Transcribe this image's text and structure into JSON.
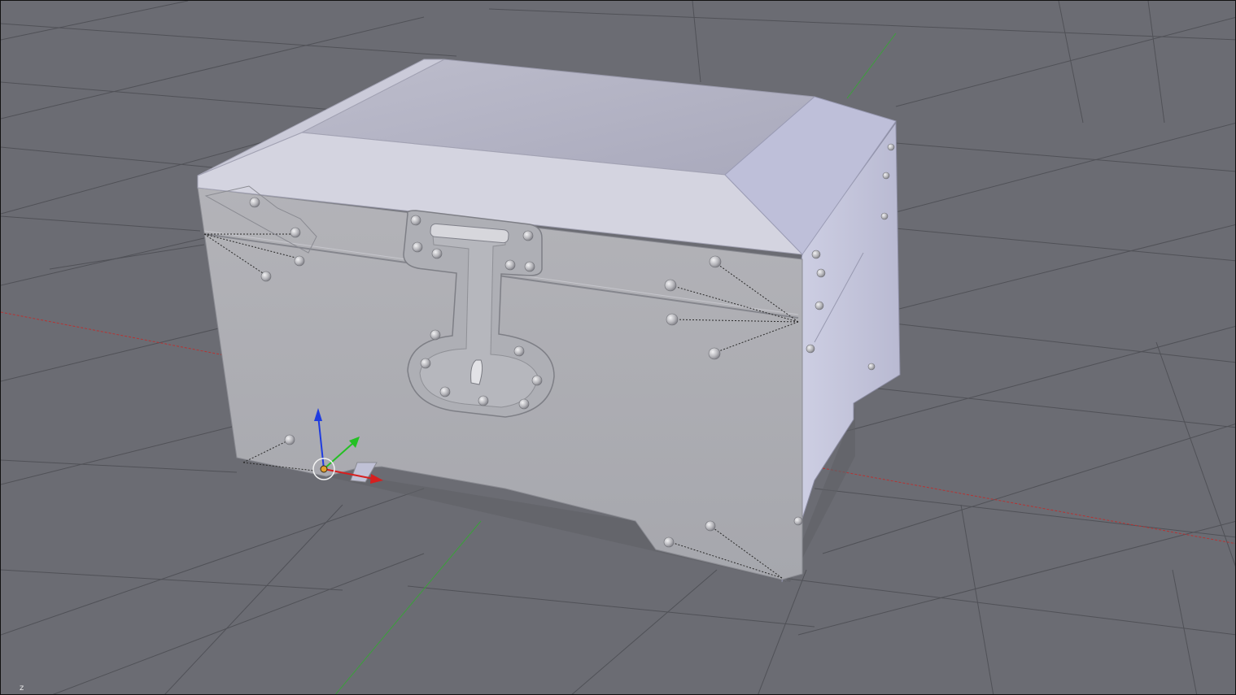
{
  "viewport": {
    "axis_corner_label": "z"
  },
  "colors": {
    "background": "#6b6c73",
    "grid_line": "#4f5056",
    "x_axis": "#b03232",
    "y_axis": "#3a9a3a",
    "gizmo_x": "#d61f1f",
    "gizmo_y": "#24c024",
    "gizmo_z": "#1f3ce0",
    "object_front": "#a9aab2",
    "object_side": "#c7c8df",
    "object_top": "#b6b6c8",
    "rivet": "#c8c8cc"
  },
  "icons": {
    "object_origin": "origin-circle-icon",
    "transform_gizmo": "translate-gizmo-icon"
  }
}
